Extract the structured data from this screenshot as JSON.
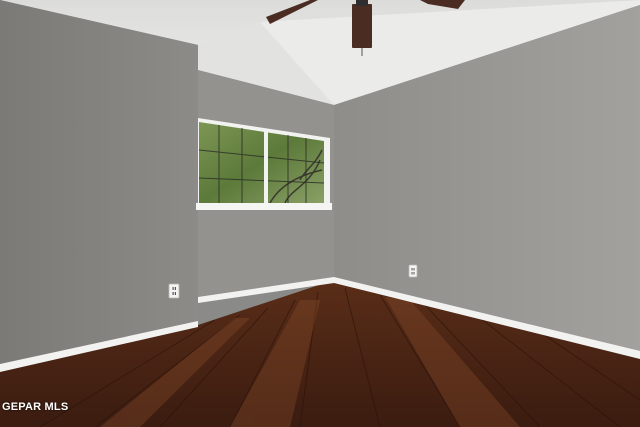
{
  "photo": {
    "watermark": "GEPAR MLS"
  },
  "colors": {
    "wall_left": "#85837f",
    "wall_back": "#96948f",
    "wall_right": "#9b9995",
    "ceiling": "#e6e6e4",
    "baseboard": "#f5f5f3",
    "floor_dark": "#3a1c10",
    "floor_mid": "#5a2e18",
    "floor_light": "#7a4226",
    "window_frame": "#f2f2f0",
    "foliage": "#6f8a4a",
    "fan_blade": "#4a2c22"
  },
  "icons": [
    "ceiling-fan-icon",
    "outlet-icon"
  ]
}
